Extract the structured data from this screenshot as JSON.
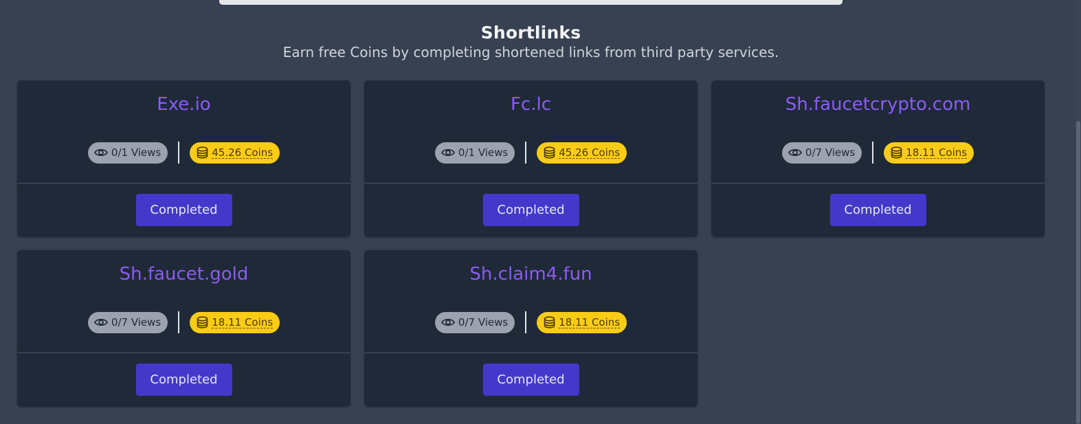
{
  "header": {
    "title": "Shortlinks",
    "subtitle": "Earn free Coins by completing shortened links from third party services."
  },
  "cards": [
    {
      "name": "Exe.io",
      "views": "0/1 Views",
      "coins": "45.26 Coins",
      "button": "Completed"
    },
    {
      "name": "Fc.lc",
      "views": "0/1 Views",
      "coins": "45.26 Coins",
      "button": "Completed"
    },
    {
      "name": "Sh.faucetcrypto.com",
      "views": "0/7 Views",
      "coins": "18.11 Coins",
      "button": "Completed"
    },
    {
      "name": "Sh.faucet.gold",
      "views": "0/7 Views",
      "coins": "18.11 Coins",
      "button": "Completed"
    },
    {
      "name": "Sh.claim4.fun",
      "views": "0/7 Views",
      "coins": "18.11 Coins",
      "button": "Completed"
    }
  ],
  "icons": {
    "views": "eye-icon",
    "coins": "coins-icon"
  },
  "colors": {
    "background": "#374151",
    "card": "#1f2937",
    "title_accent": "#8b5cf6",
    "button": "#4338ca",
    "coins_badge": "#facc15",
    "views_badge": "#9ca3af"
  }
}
